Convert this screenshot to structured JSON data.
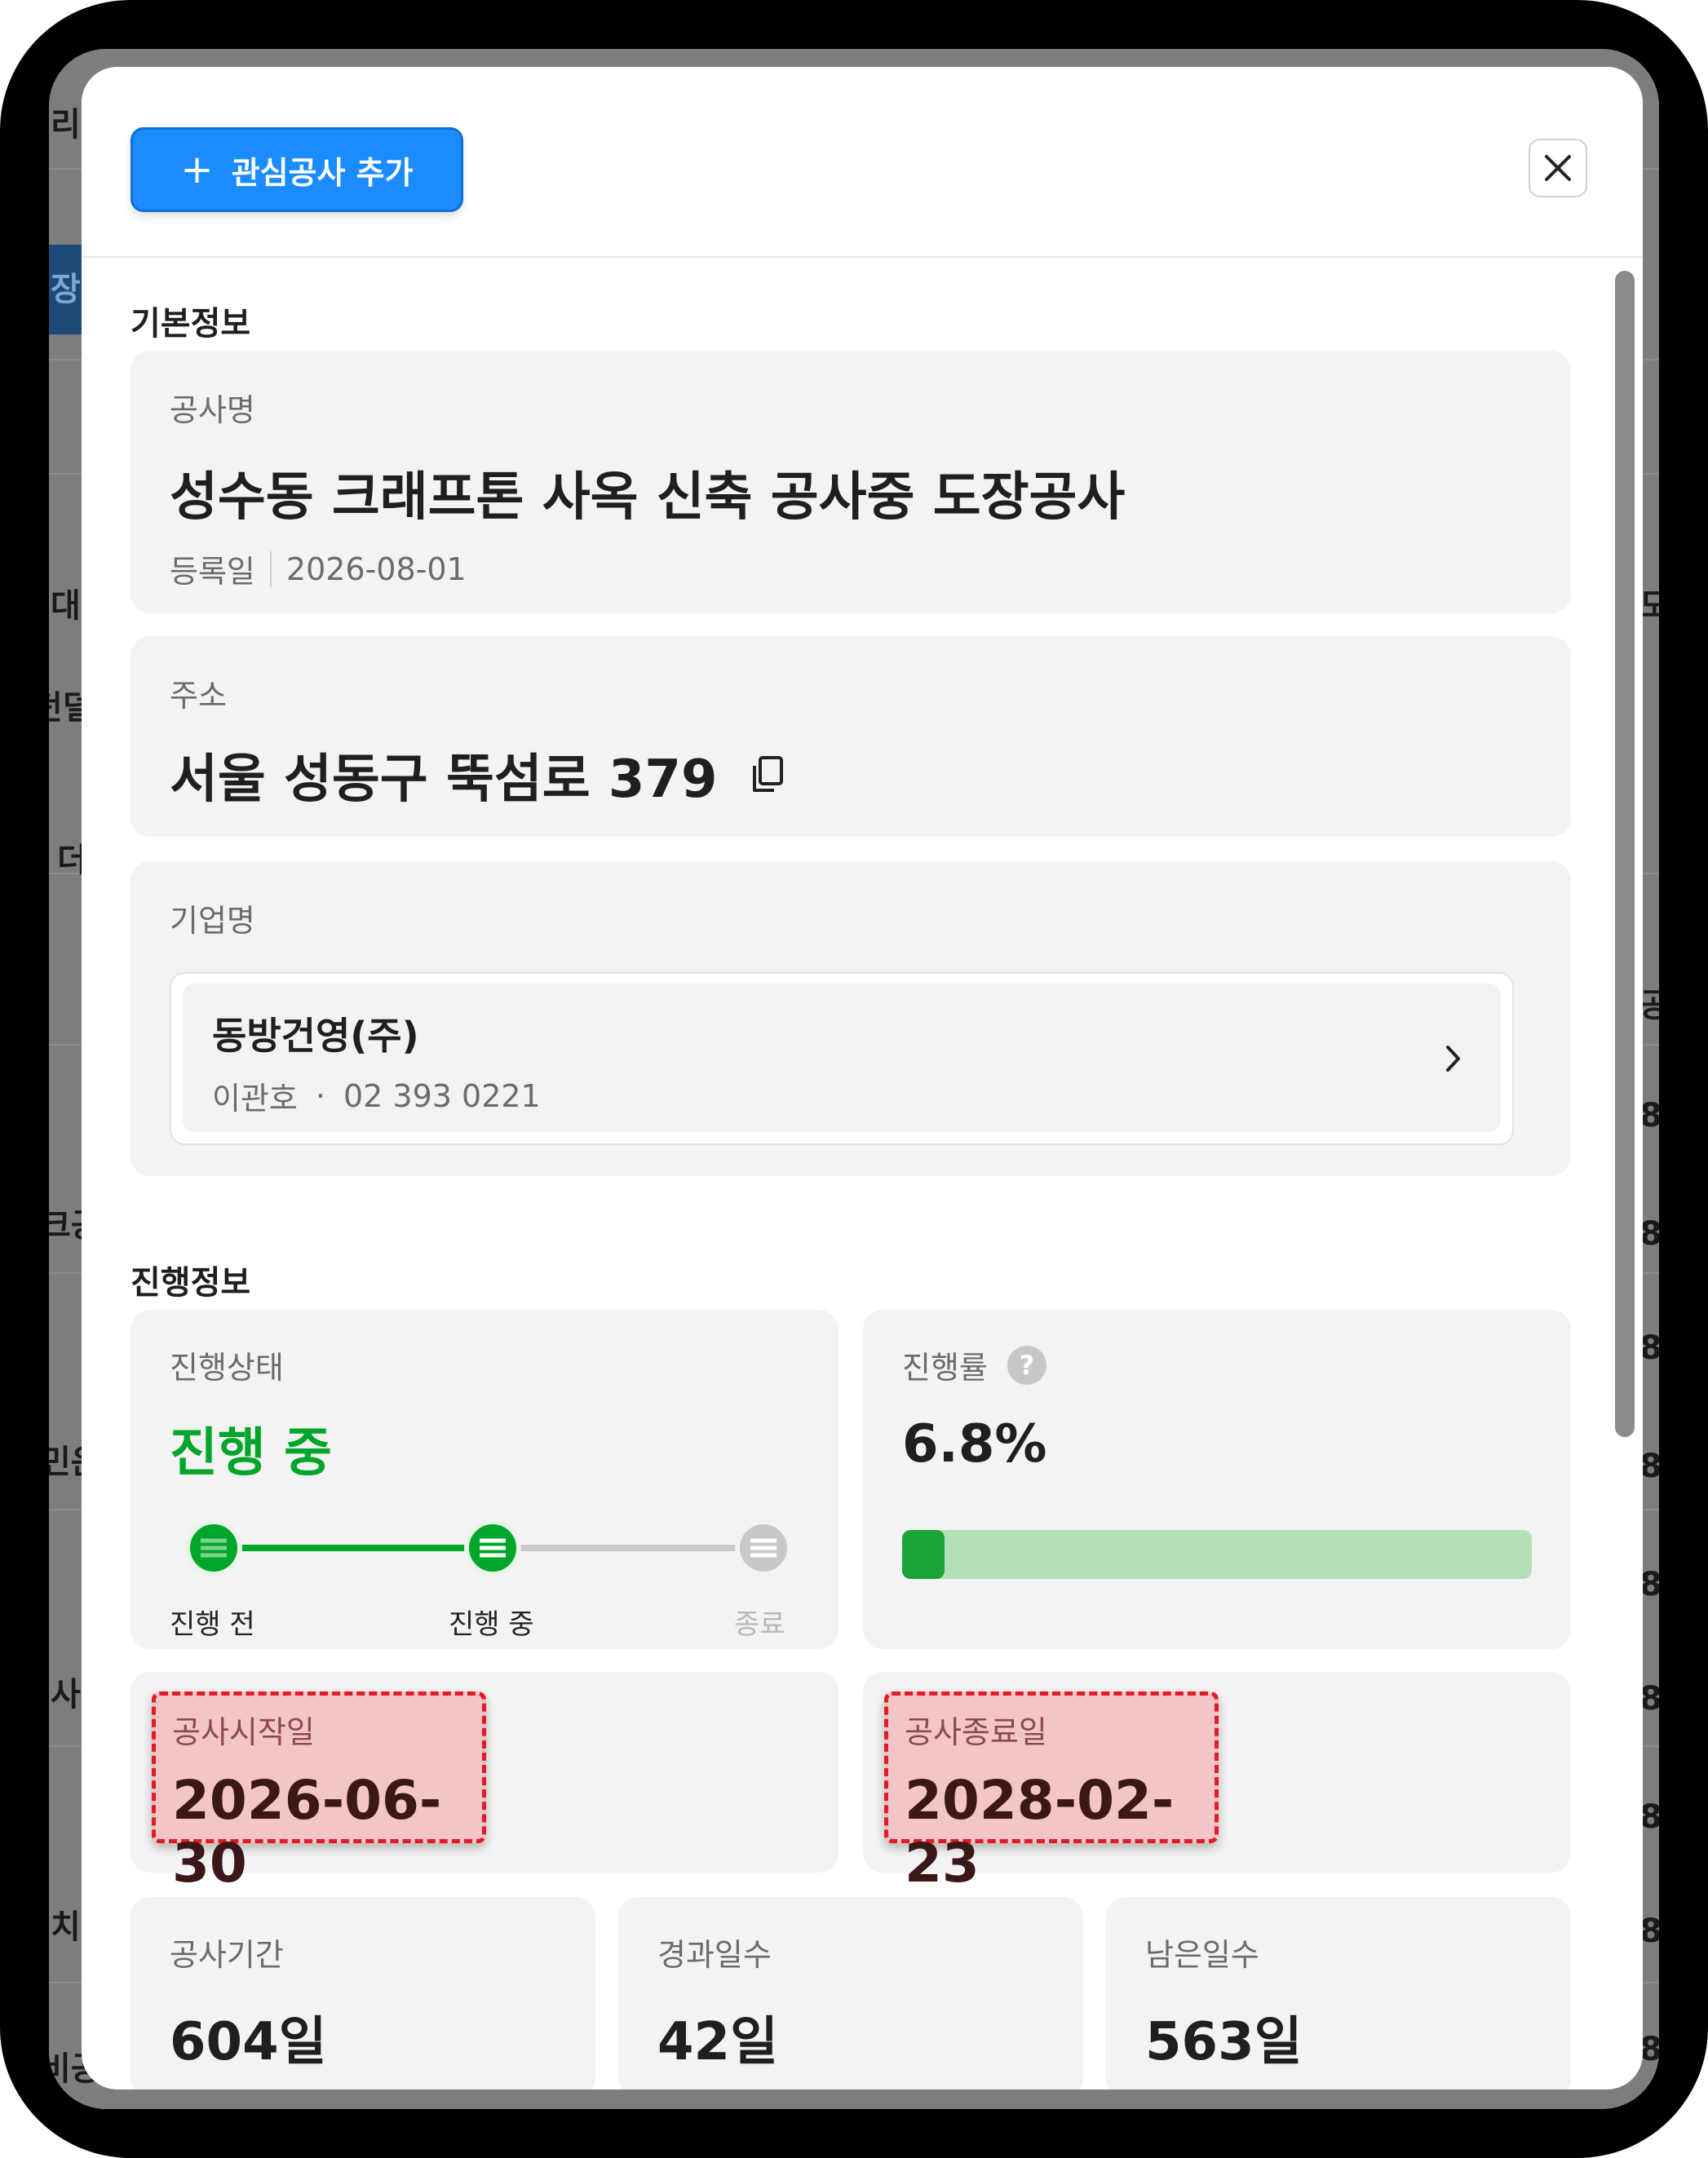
{
  "modal": {
    "add_button_label": "관심공사 추가",
    "add_button_icon": "plus-icon",
    "close_icon": "close-icon"
  },
  "basic_info": {
    "section_title": "기본정보",
    "project": {
      "label": "공사명",
      "name": "성수동 크래프톤 사옥 신축 공사중 도장공사",
      "registered_label": "등록일",
      "registered_date": "2026-08-01"
    },
    "address": {
      "label": "주소",
      "value": "서울 성동구 뚝섬로 379",
      "copy_icon": "copy-icon"
    },
    "company": {
      "label": "기업명",
      "name": "동방건영(주)",
      "contact_name": "이관호",
      "separator": "·",
      "phone": "02 393 0221",
      "chevron_icon": "chevron-right-icon"
    }
  },
  "progress_info": {
    "section_title": "진행정보",
    "status": {
      "label": "진행상태",
      "value": "진행 중",
      "steps": [
        "진행 전",
        "진행 중",
        "종료"
      ],
      "active_step_index": 1,
      "active_color": "#00a62a",
      "inactive_color": "#c9c9c9"
    },
    "rate": {
      "label": "진행률",
      "help_icon": "question-icon",
      "value_text": "6.8%",
      "value": 0.068,
      "fill_color": "#1aa536",
      "track_color": "#b4e0b8"
    },
    "start_date": {
      "label": "공사시작일",
      "value": "2026-06-30"
    },
    "end_date": {
      "label": "공사종료일",
      "value": "2028-02-23"
    },
    "duration": {
      "label": "공사기간",
      "value": "604일"
    },
    "elapsed": {
      "label": "경과일수",
      "value": "42일"
    },
    "remaining": {
      "label": "남은일수",
      "value": "563일"
    }
  },
  "background": {
    "left_fragments": [
      "리",
      "장",
      "대",
      "던덜",
      "더",
      "크공",
      "민운",
      "사",
      "치",
      "비공"
    ],
    "right_fragments": [
      "도",
      "공",
      "8",
      "8",
      "8",
      "8",
      "8",
      "8",
      "8",
      "8",
      "8"
    ]
  }
}
